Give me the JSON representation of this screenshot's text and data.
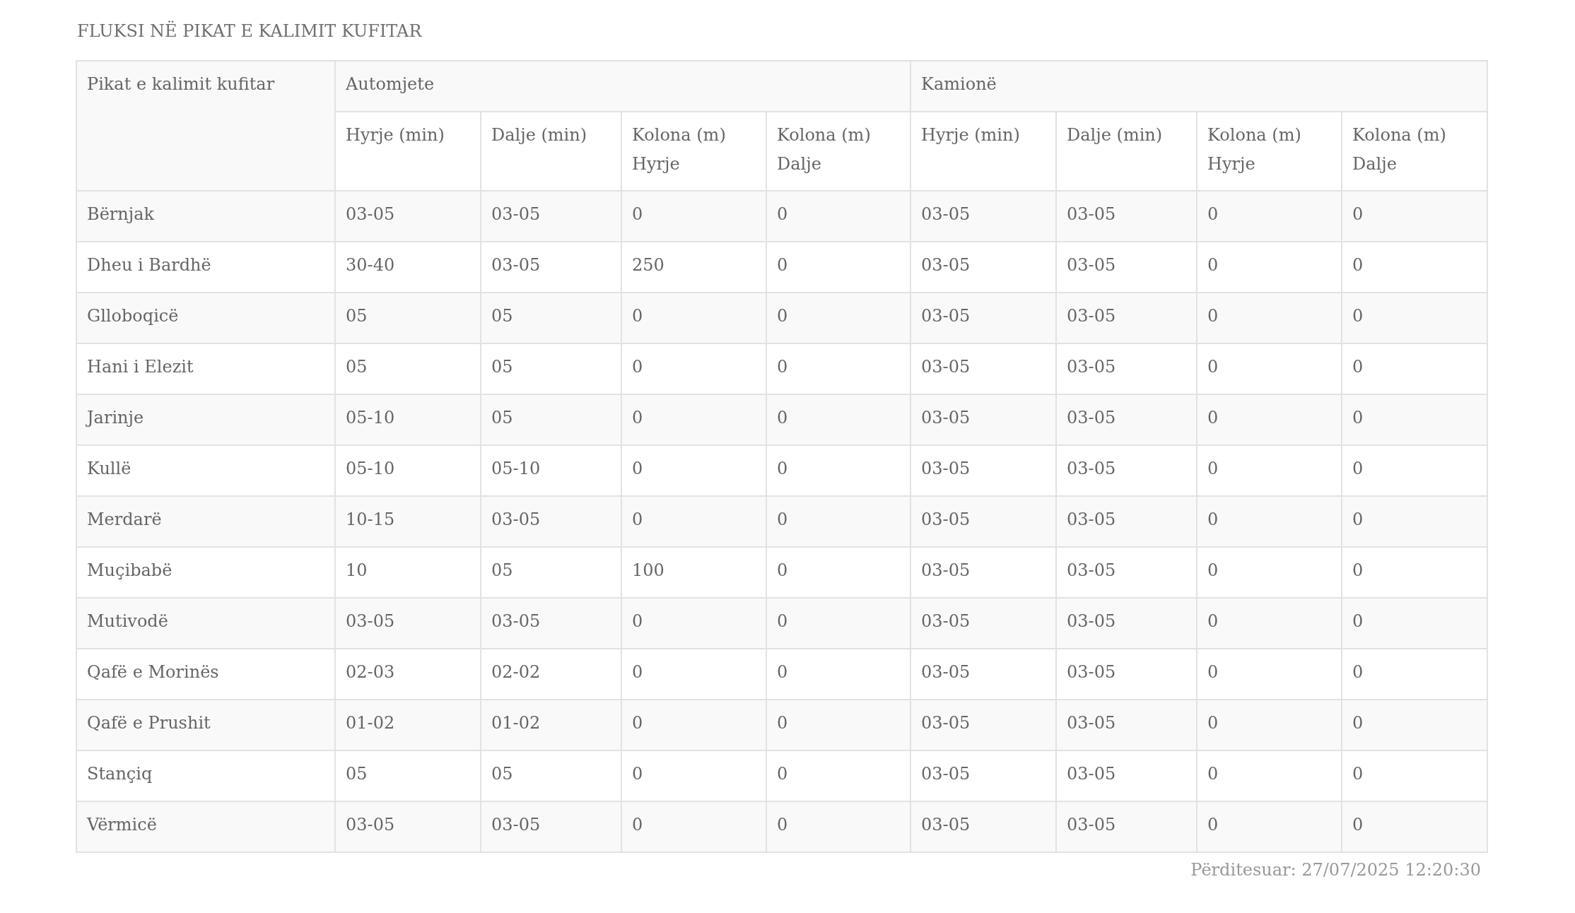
{
  "title": "FLUKSI NË PIKAT E KALIMIT KUFITAR",
  "table": {
    "corner_header": "Pikat e kalimit kufitar",
    "groups": [
      {
        "label": "Automjete",
        "columns": [
          "Hyrje (min)",
          "Dalje (min)",
          "Kolona (m) Hyrje",
          "Kolona (m) Dalje"
        ]
      },
      {
        "label": "Kamionë",
        "columns": [
          "Hyrje (min)",
          "Dalje (min)",
          "Kolona (m) Hyrje",
          "Kolona (m) Dalje"
        ]
      }
    ],
    "rows": [
      {
        "name": "Bërnjak",
        "cells": [
          "03-05",
          "03-05",
          "0",
          "0",
          "03-05",
          "03-05",
          "0",
          "0"
        ]
      },
      {
        "name": "Dheu i Bardhë",
        "cells": [
          "30-40",
          "03-05",
          "250",
          "0",
          "03-05",
          "03-05",
          "0",
          "0"
        ]
      },
      {
        "name": "Glloboqicë",
        "cells": [
          "05",
          "05",
          "0",
          "0",
          "03-05",
          "03-05",
          "0",
          "0"
        ]
      },
      {
        "name": "Hani i Elezit",
        "cells": [
          "05",
          "05",
          "0",
          "0",
          "03-05",
          "03-05",
          "0",
          "0"
        ]
      },
      {
        "name": "Jarinje",
        "cells": [
          "05-10",
          "05",
          "0",
          "0",
          "03-05",
          "03-05",
          "0",
          "0"
        ]
      },
      {
        "name": "Kullë",
        "cells": [
          "05-10",
          "05-10",
          "0",
          "0",
          "03-05",
          "03-05",
          "0",
          "0"
        ]
      },
      {
        "name": "Merdarë",
        "cells": [
          "10-15",
          "03-05",
          "0",
          "0",
          "03-05",
          "03-05",
          "0",
          "0"
        ]
      },
      {
        "name": "Muçibabë",
        "cells": [
          "10",
          "05",
          "100",
          "0",
          "03-05",
          "03-05",
          "0",
          "0"
        ]
      },
      {
        "name": "Mutivodë",
        "cells": [
          "03-05",
          "03-05",
          "0",
          "0",
          "03-05",
          "03-05",
          "0",
          "0"
        ]
      },
      {
        "name": "Qafë e Morinës",
        "cells": [
          "02-03",
          "02-02",
          "0",
          "0",
          "03-05",
          "03-05",
          "0",
          "0"
        ]
      },
      {
        "name": "Qafë e Prushit",
        "cells": [
          "01-02",
          "01-02",
          "0",
          "0",
          "03-05",
          "03-05",
          "0",
          "0"
        ]
      },
      {
        "name": "Stançiq",
        "cells": [
          "05",
          "05",
          "0",
          "0",
          "03-05",
          "03-05",
          "0",
          "0"
        ]
      },
      {
        "name": "Vërmicë",
        "cells": [
          "03-05",
          "03-05",
          "0",
          "0",
          "03-05",
          "03-05",
          "0",
          "0"
        ]
      }
    ]
  },
  "updated": "Përditesuar: 27/07/2025 12:20:30"
}
